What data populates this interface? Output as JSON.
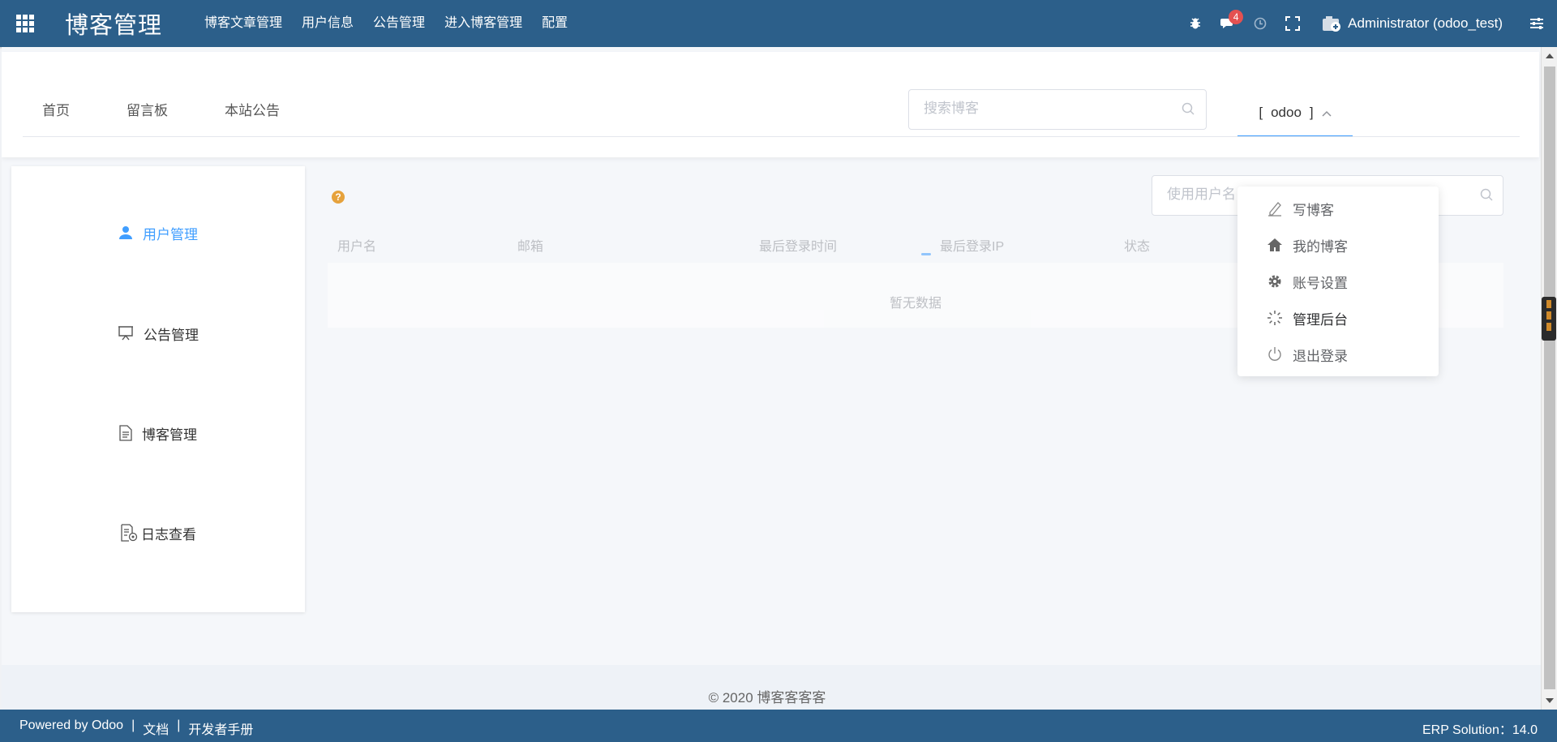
{
  "topbar": {
    "brand": "博客管理",
    "menu": [
      "博客文章管理",
      "用户信息",
      "公告管理",
      "进入博客管理",
      "配置"
    ],
    "message_count": "4",
    "user": "Administrator (odoo_test)"
  },
  "blog_header": {
    "nav": [
      "首页",
      "留言板",
      "本站公告"
    ],
    "search_placeholder": "搜索博客",
    "account_prefix": "[",
    "account_name": "odoo",
    "account_suffix": "]"
  },
  "dropdown": {
    "items": [
      "写博客",
      "我的博客",
      "账号设置",
      "管理后台",
      "退出登录"
    ]
  },
  "sidebar": {
    "items": [
      "用户管理",
      "公告管理",
      "博客管理",
      "日志查看"
    ]
  },
  "main": {
    "user_search_placeholder": "使用用户名",
    "columns": [
      "用户名",
      "邮箱",
      "最后登录时间",
      "最后登录IP",
      "状态"
    ],
    "empty_text": "暂无数据"
  },
  "footer": {
    "copyright": "© 2020 博客客客客"
  },
  "bottombar": {
    "powered": "Powered by Odoo",
    "sep": "|",
    "docs": "文档",
    "dev": "开发者手册",
    "erp": "ERP Solution：14.0"
  },
  "colors": {
    "navbar": "#2c5f8a",
    "accent": "#409eff",
    "badge": "#e45151",
    "help": "#e6a23c"
  }
}
